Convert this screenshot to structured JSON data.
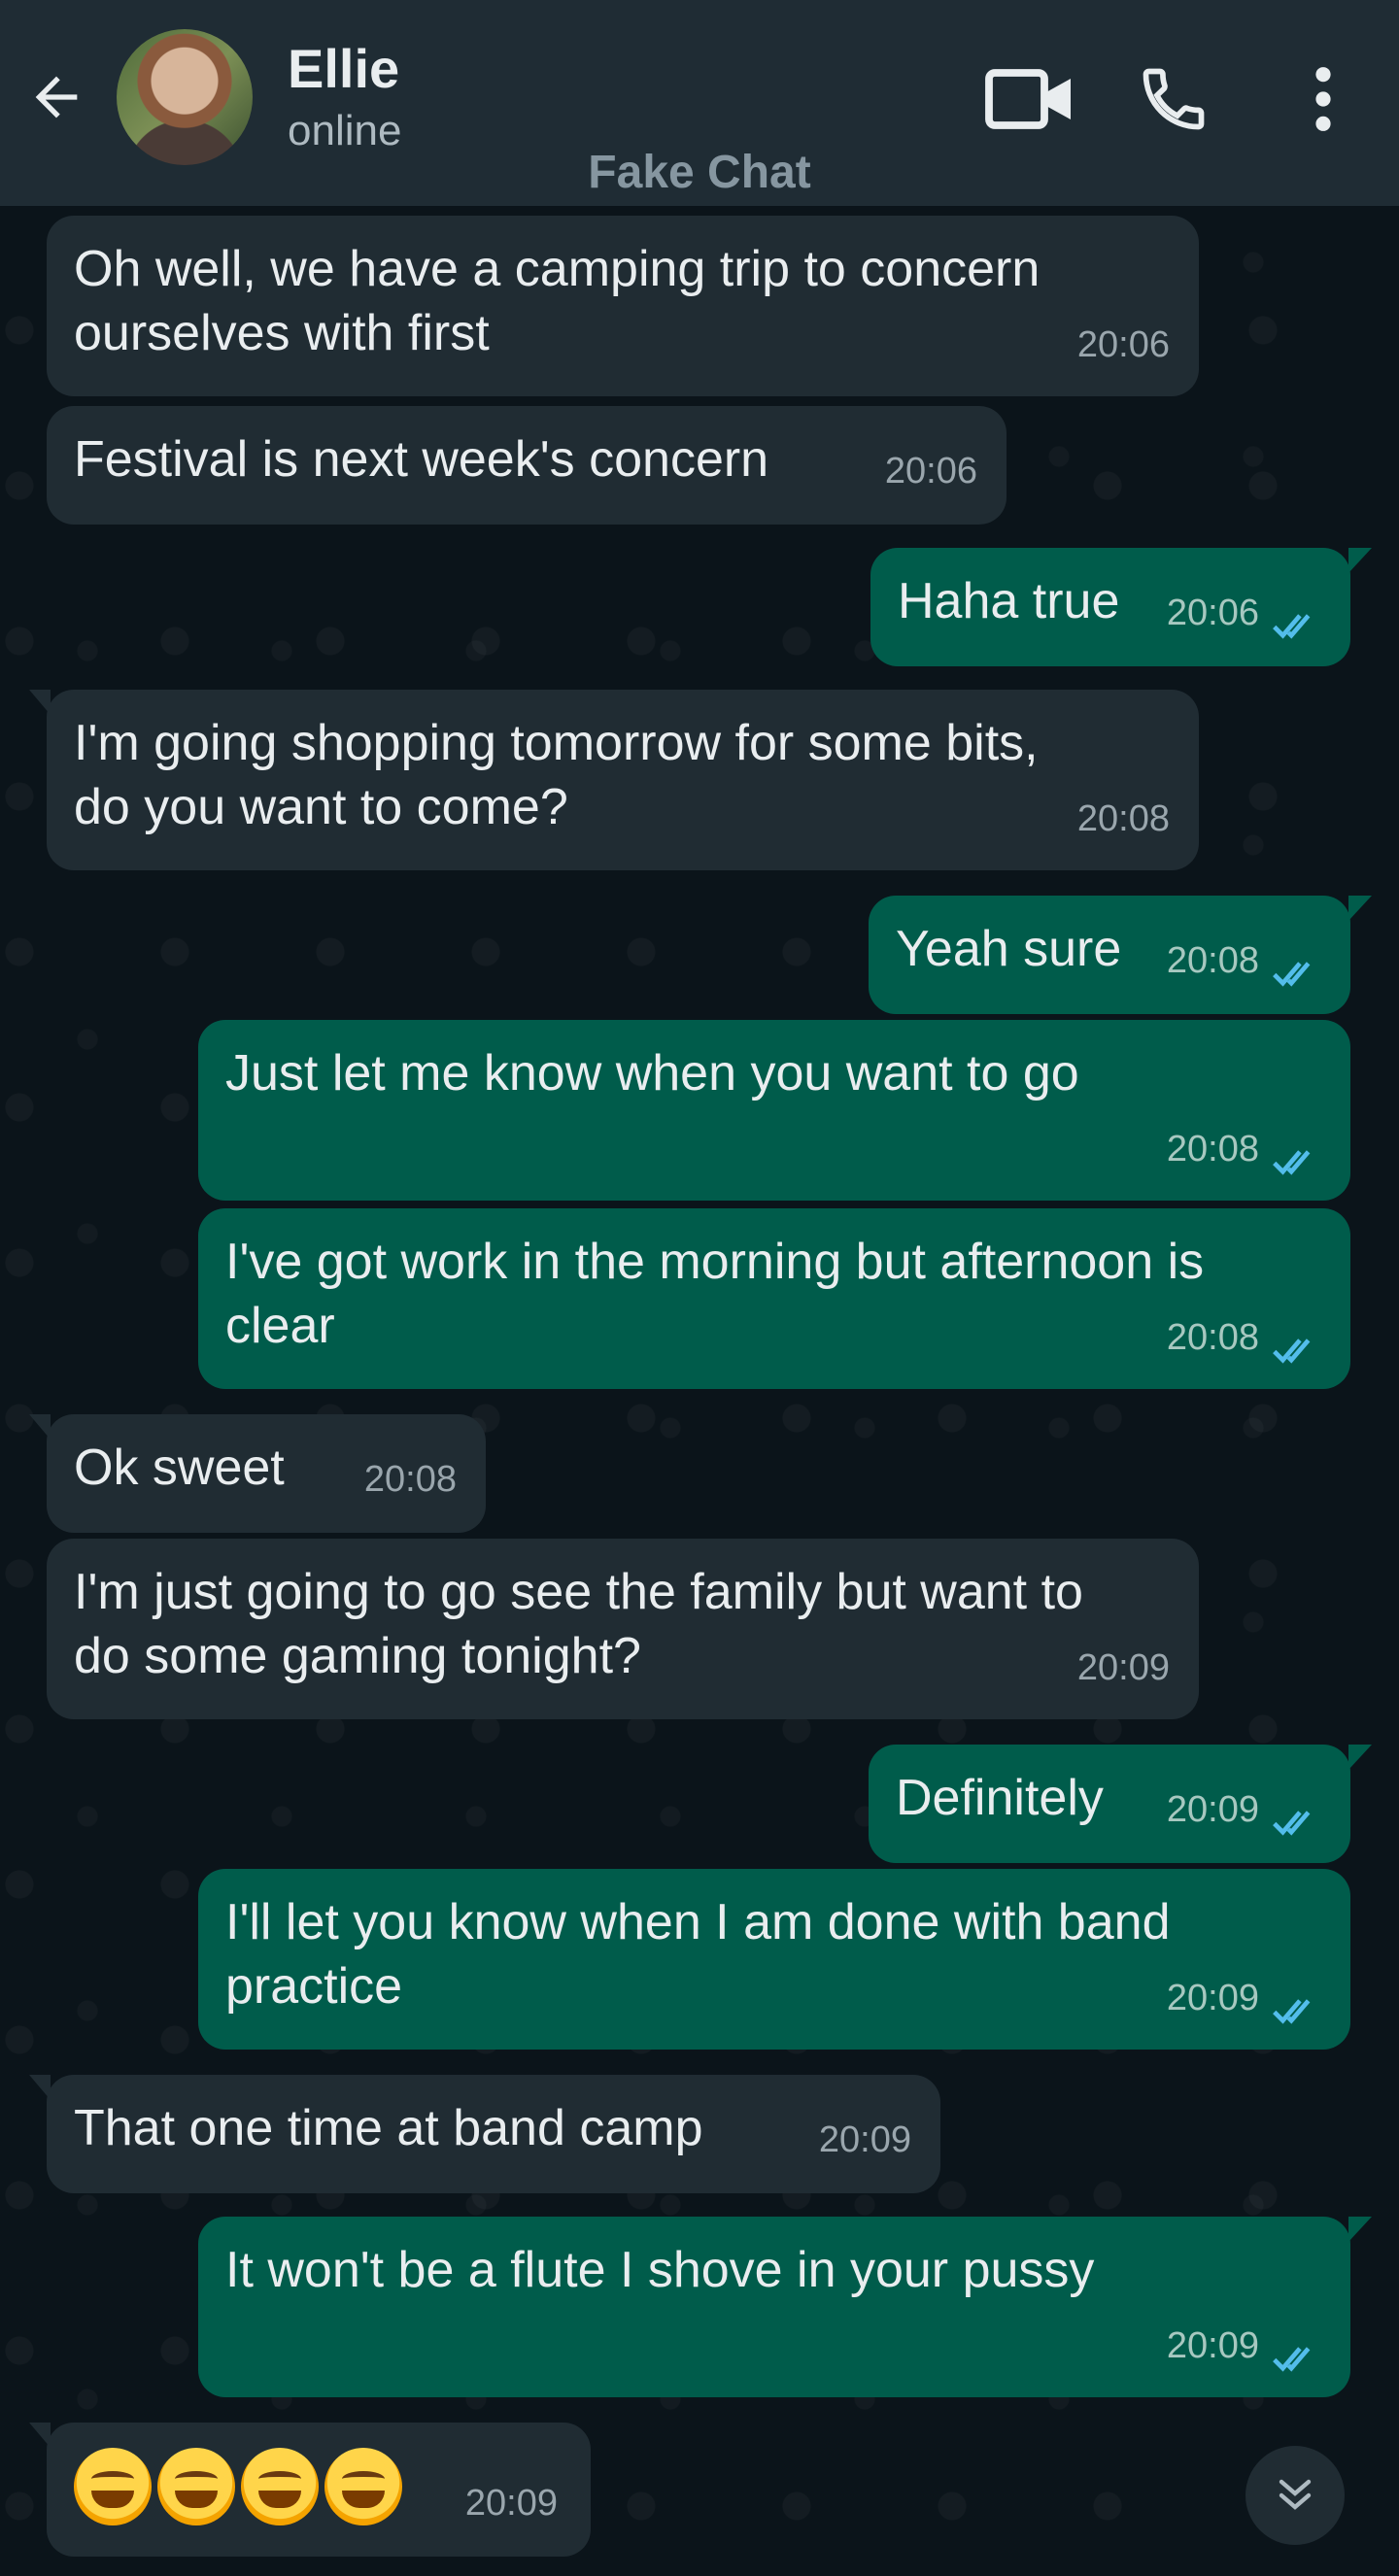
{
  "header": {
    "contact_name": "Ellie",
    "status": "online",
    "watermark": "Fake Chat",
    "icons": [
      "back-arrow-icon",
      "avatar",
      "video-call-icon",
      "phone-icon",
      "more-vert-icon"
    ]
  },
  "colors": {
    "header_bg": "#1f2c34",
    "chat_bg": "#0b141a",
    "incoming_bubble": "#202c33",
    "outgoing_bubble": "#005c4b",
    "read_ticks": "#53bdeb"
  },
  "messages": [
    {
      "dir": "in",
      "lines": [
        "Oh well, we have a camping trip to concern",
        "ourselves with first"
      ],
      "time": "20:06"
    },
    {
      "dir": "in",
      "lines": [
        "Festival is next week's concern"
      ],
      "time": "20:06"
    },
    {
      "dir": "out",
      "lines": [
        "Haha true"
      ],
      "time": "20:06"
    },
    {
      "dir": "in",
      "lines": [
        "I'm going shopping tomorrow for some bits,",
        "do you want to come?"
      ],
      "time": "20:08"
    },
    {
      "dir": "out",
      "lines": [
        "Yeah sure"
      ],
      "time": "20:08"
    },
    {
      "dir": "out",
      "lines": [
        "Just let me know when you want to go"
      ],
      "time": "20:08"
    },
    {
      "dir": "out",
      "lines": [
        "I've got work in the morning but afternoon is",
        "clear"
      ],
      "time": "20:08"
    },
    {
      "dir": "in",
      "lines": [
        "Ok sweet"
      ],
      "time": "20:08"
    },
    {
      "dir": "in",
      "lines": [
        "I'm just going to go see the family but want to",
        "do some gaming tonight?"
      ],
      "time": "20:09"
    },
    {
      "dir": "out",
      "lines": [
        "Definitely"
      ],
      "time": "20:09"
    },
    {
      "dir": "out",
      "lines": [
        "I'll let you know when I am done with band",
        "practice"
      ],
      "time": "20:09"
    },
    {
      "dir": "in",
      "lines": [
        "That one time at band camp"
      ],
      "time": "20:09"
    },
    {
      "dir": "out",
      "lines": [
        "It won't be a flute I shove in your pussy"
      ],
      "time": "20:09"
    },
    {
      "dir": "in",
      "emoji": "🤣🤣🤣🤣",
      "time": "20:09"
    }
  ],
  "scroll_button_icon": "double-chevron-down-icon"
}
